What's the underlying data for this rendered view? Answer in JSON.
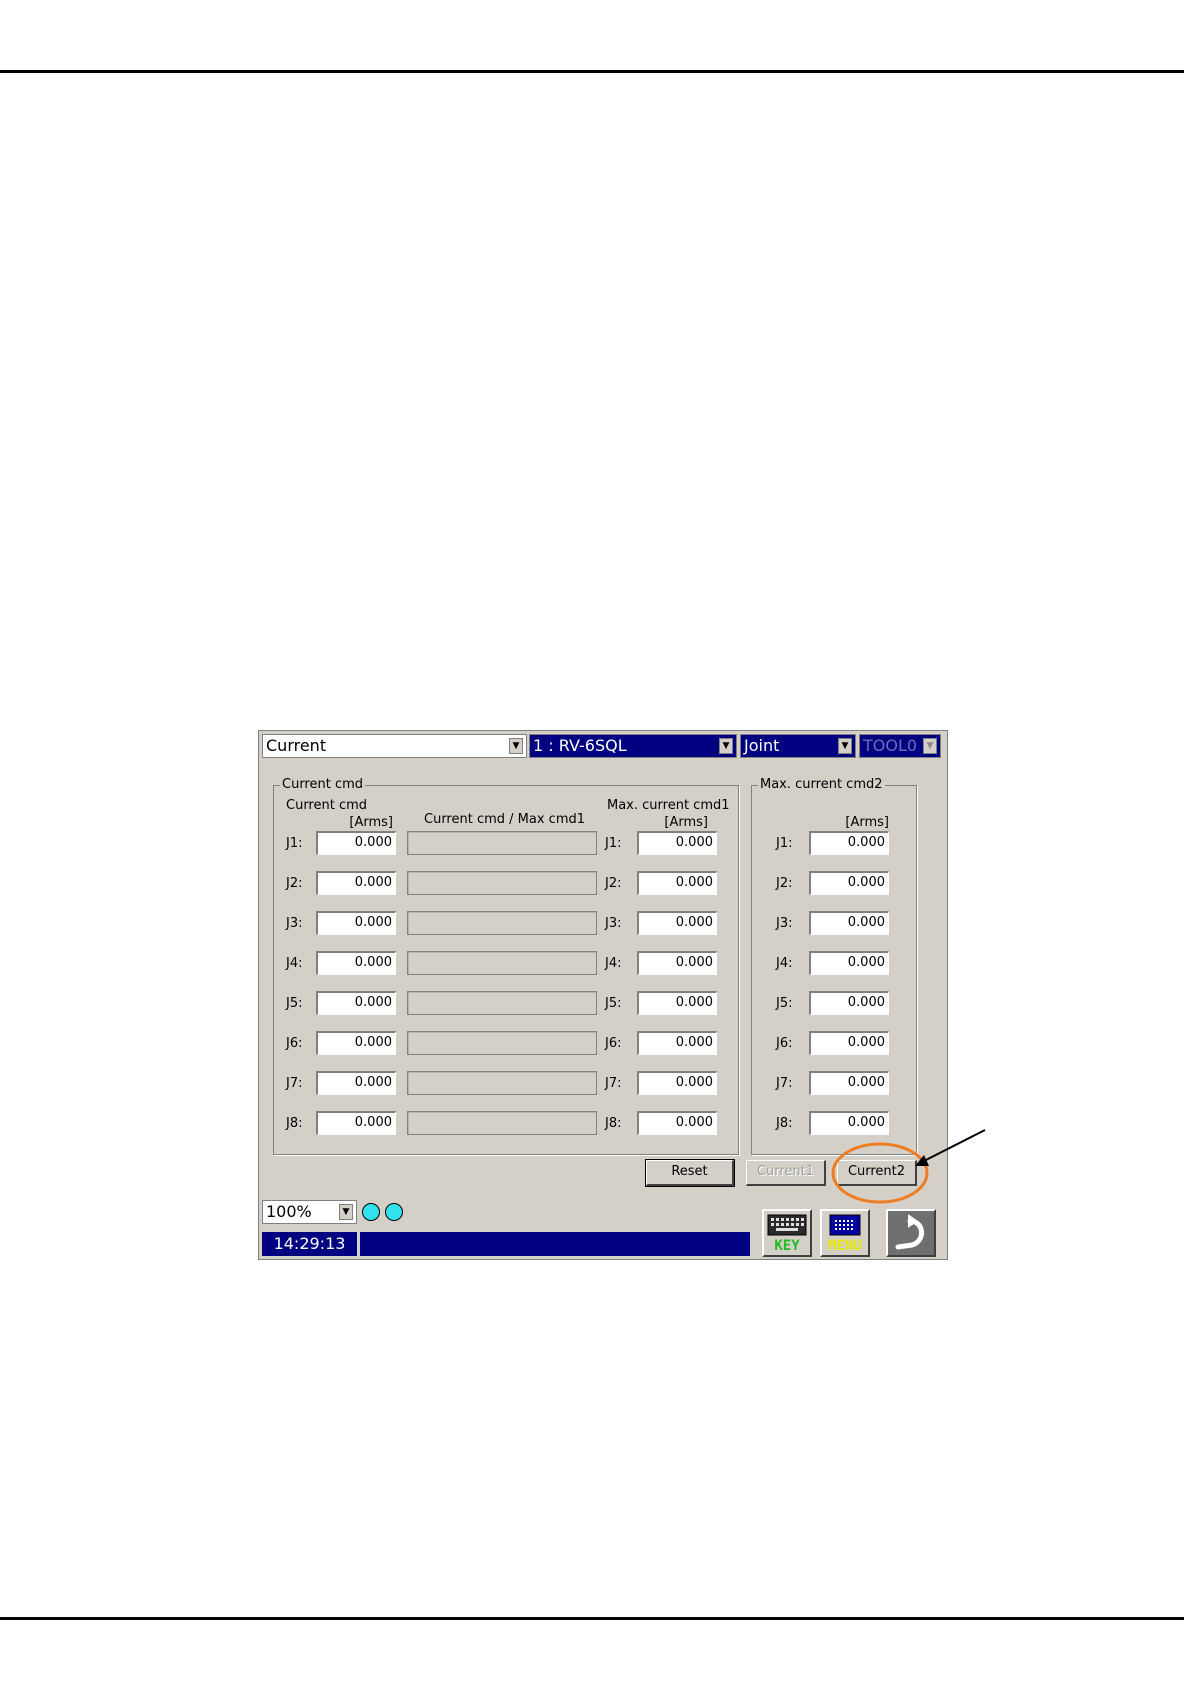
{
  "toolbar": {
    "monitor_select": "Current",
    "robot_select": "1 : RV-6SQL",
    "coord_select": "Joint",
    "tool_select": "TOOL0"
  },
  "group1": {
    "title": "Current cmd",
    "col1_header": "Current cmd",
    "col1_unit": "[Arms]",
    "col2_header": "Current cmd / Max cmd1",
    "col3_header": "Max. current cmd1",
    "col3_unit": "[Arms]",
    "rows": [
      {
        "label": "J1:",
        "current": "0.000",
        "max_label": "J1:",
        "max": "0.000"
      },
      {
        "label": "J2:",
        "current": "0.000",
        "max_label": "J2:",
        "max": "0.000"
      },
      {
        "label": "J3:",
        "current": "0.000",
        "max_label": "J3:",
        "max": "0.000"
      },
      {
        "label": "J4:",
        "current": "0.000",
        "max_label": "J4:",
        "max": "0.000"
      },
      {
        "label": "J5:",
        "current": "0.000",
        "max_label": "J5:",
        "max": "0.000"
      },
      {
        "label": "J6:",
        "current": "0.000",
        "max_label": "J6:",
        "max": "0.000"
      },
      {
        "label": "J7:",
        "current": "0.000",
        "max_label": "J7:",
        "max": "0.000"
      },
      {
        "label": "J8:",
        "current": "0.000",
        "max_label": "J8:",
        "max": "0.000"
      }
    ]
  },
  "group2": {
    "title": "Max. current cmd2",
    "unit": "[Arms]",
    "rows": [
      {
        "label": "J1:",
        "value": "0.000"
      },
      {
        "label": "J2:",
        "value": "0.000"
      },
      {
        "label": "J3:",
        "value": "0.000"
      },
      {
        "label": "J4:",
        "value": "0.000"
      },
      {
        "label": "J5:",
        "value": "0.000"
      },
      {
        "label": "J6:",
        "value": "0.000"
      },
      {
        "label": "J7:",
        "value": "0.000"
      },
      {
        "label": "J8:",
        "value": "0.000"
      }
    ]
  },
  "buttons": {
    "reset": "Reset",
    "current1": "Current1",
    "current2": "Current2"
  },
  "footer": {
    "speed": "100%",
    "time": "14:29:13",
    "status_message": "",
    "key_label": "KEY",
    "menu_label": "MENU"
  },
  "colors": {
    "highlight": "#ee7d22",
    "indicator": "#33e0ee",
    "panel": "#d4d0c8",
    "navy": "#000080"
  }
}
